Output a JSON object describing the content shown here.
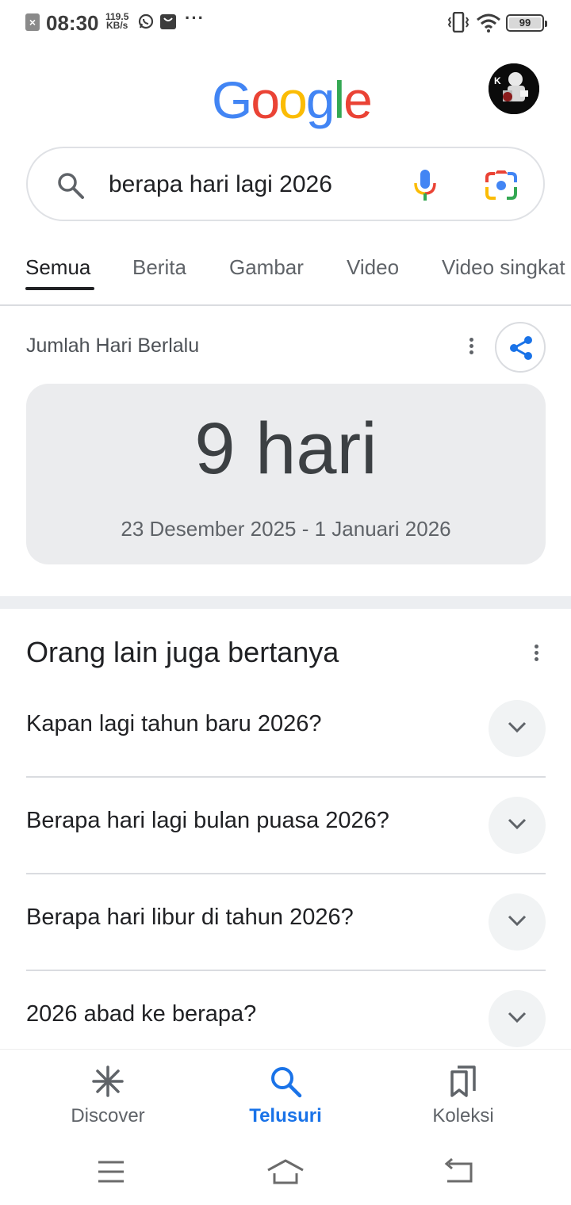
{
  "status_bar": {
    "time": "08:30",
    "net_speed_value": "119.5",
    "net_speed_unit": "KB/s",
    "more": "···",
    "battery": "99"
  },
  "header": {
    "logo_letters": [
      {
        "char": "G",
        "color": "#4285F4"
      },
      {
        "char": "o",
        "color": "#EA4335"
      },
      {
        "char": "o",
        "color": "#FBBC05"
      },
      {
        "char": "g",
        "color": "#4285F4"
      },
      {
        "char": "l",
        "color": "#34A853"
      },
      {
        "char": "e",
        "color": "#EA4335"
      }
    ]
  },
  "search": {
    "query": "berapa hari lagi 2026"
  },
  "tabs": [
    {
      "label": "Semua",
      "active": true
    },
    {
      "label": "Berita",
      "active": false
    },
    {
      "label": "Gambar",
      "active": false
    },
    {
      "label": "Video",
      "active": false
    },
    {
      "label": "Video singkat",
      "active": false
    }
  ],
  "result": {
    "title": "Jumlah Hari Berlalu",
    "value": "9 hari",
    "range": "23 Desember 2025 - 1 Januari 2026"
  },
  "paa": {
    "title": "Orang lain juga bertanya",
    "questions": [
      "Kapan lagi tahun baru 2026?",
      "Berapa hari lagi bulan puasa 2026?",
      "Berapa hari libur di tahun 2026?",
      "2026 abad ke berapa?"
    ]
  },
  "bottom_nav": {
    "items": [
      {
        "label": "Discover",
        "icon": "asterisk-icon",
        "active": false
      },
      {
        "label": "Telusuri",
        "icon": "search-icon",
        "active": true
      },
      {
        "label": "Koleksi",
        "icon": "bookmarks-icon",
        "active": false
      }
    ]
  },
  "colors": {
    "accent": "#1a73e8",
    "text": "#202124",
    "muted": "#5f6368",
    "result_bg": "#ebecee"
  }
}
